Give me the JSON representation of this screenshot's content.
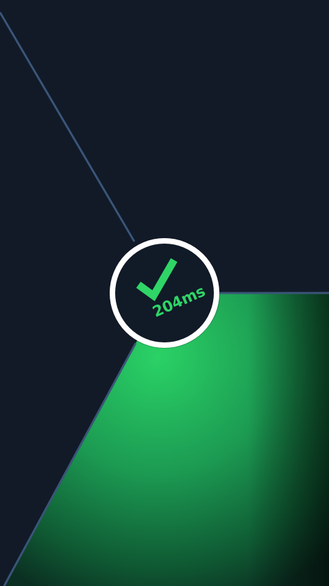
{
  "game": {
    "latency_label": "204ms",
    "status_icon": "check-icon",
    "colors": {
      "background": "#121a28",
      "divider": "#3a5578",
      "success_green": "#2fd567",
      "active_sector": "#1f9c58",
      "hub_ring": "#ffffff"
    }
  }
}
